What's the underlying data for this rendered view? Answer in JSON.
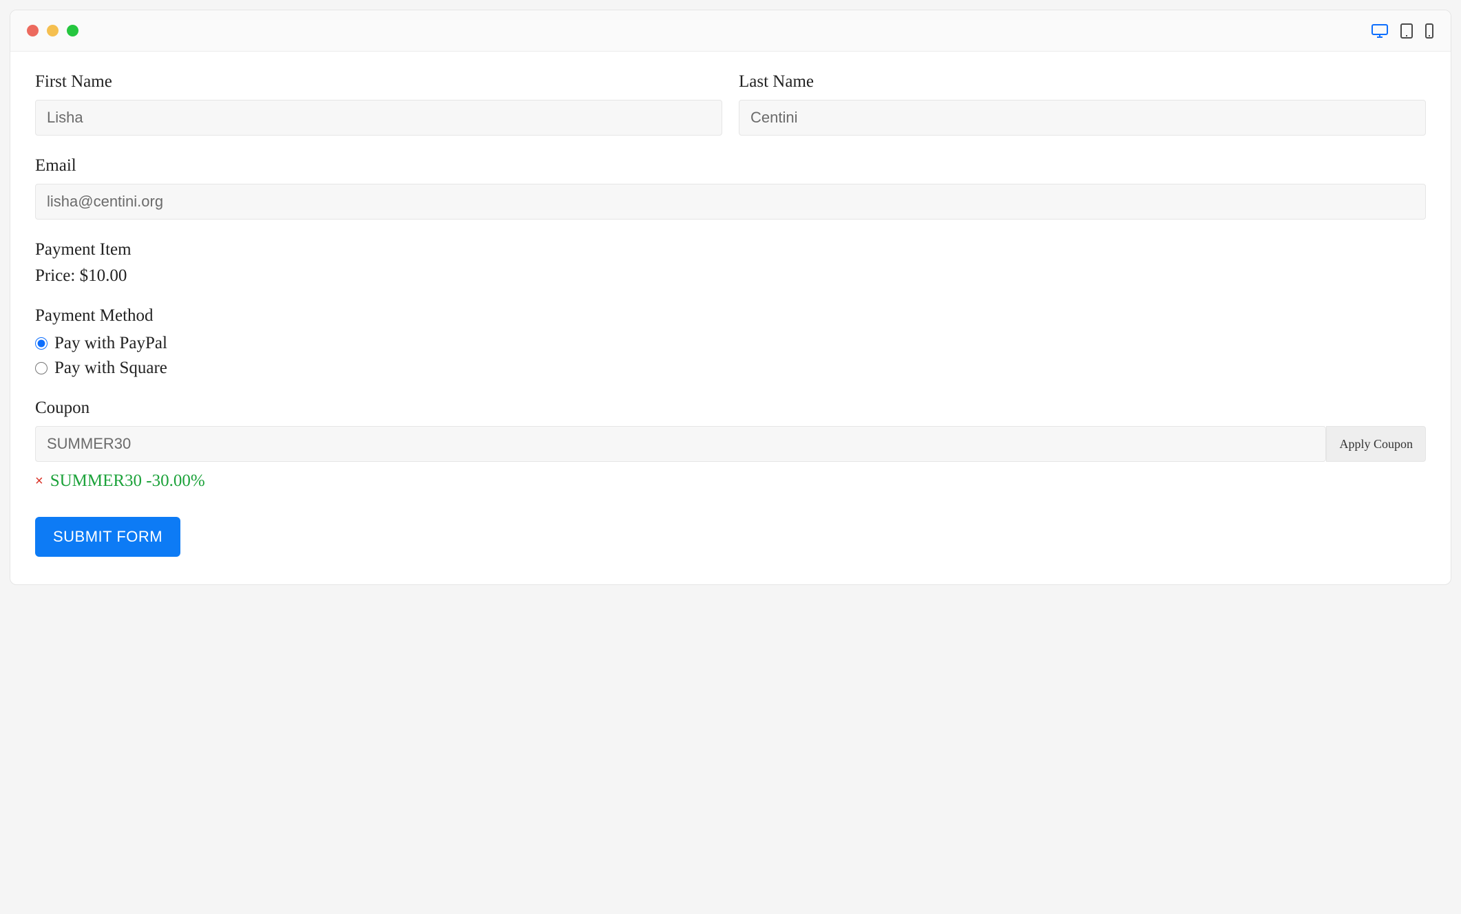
{
  "form": {
    "first_name": {
      "label": "First Name",
      "value": "Lisha"
    },
    "last_name": {
      "label": "Last Name",
      "value": "Centini"
    },
    "email": {
      "label": "Email",
      "value": "lisha@centini.org"
    },
    "payment_item": {
      "heading": "Payment Item",
      "price_line": "Price: $10.00"
    },
    "payment_method": {
      "heading": "Payment Method",
      "options": {
        "paypal": "Pay with PayPal",
        "square": "Pay with Square"
      },
      "selected": "paypal"
    },
    "coupon": {
      "label": "Coupon",
      "value": "SUMMER30",
      "apply_label": "Apply Coupon",
      "applied_text": "SUMMER30 -30.00%"
    },
    "submit_label": "SUBMIT FORM"
  }
}
